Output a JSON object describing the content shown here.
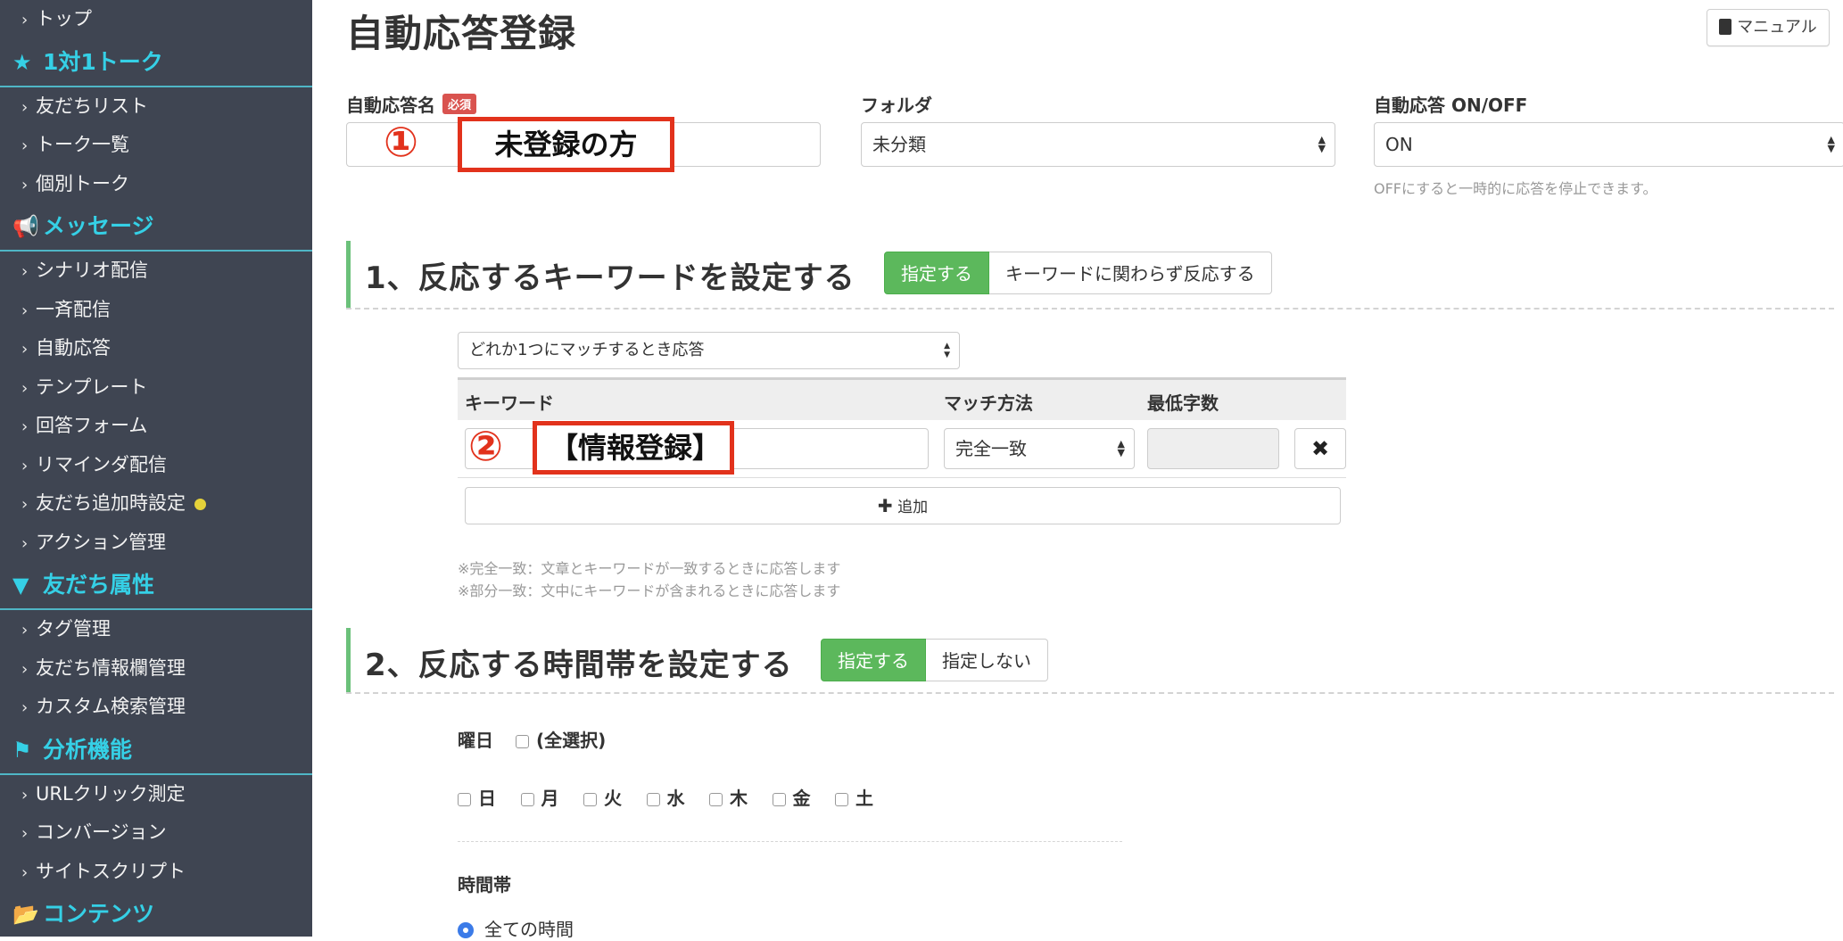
{
  "sidebar": {
    "items": [
      {
        "kind": "item",
        "label": "トップ"
      },
      {
        "kind": "section",
        "label": "1対1トーク",
        "icon": "star-icon",
        "glyph": "★"
      },
      {
        "kind": "item",
        "label": "友だちリスト"
      },
      {
        "kind": "item",
        "label": "トーク一覧"
      },
      {
        "kind": "item",
        "label": "個別トーク"
      },
      {
        "kind": "section",
        "label": "メッセージ",
        "icon": "megaphone-icon",
        "glyph": "📢"
      },
      {
        "kind": "item",
        "label": "シナリオ配信"
      },
      {
        "kind": "item",
        "label": "一斉配信"
      },
      {
        "kind": "item",
        "label": "自動応答"
      },
      {
        "kind": "item",
        "label": "テンプレート"
      },
      {
        "kind": "item",
        "label": "回答フォーム"
      },
      {
        "kind": "item",
        "label": "リマインダ配信"
      },
      {
        "kind": "item",
        "label": "友だち追加時設定",
        "dot": true
      },
      {
        "kind": "item",
        "label": "アクション管理"
      },
      {
        "kind": "section",
        "label": "友だち属性",
        "icon": "filter-icon",
        "glyph": "▼"
      },
      {
        "kind": "item",
        "label": "タグ管理"
      },
      {
        "kind": "item",
        "label": "友だち情報欄管理"
      },
      {
        "kind": "item",
        "label": "カスタム検索管理"
      },
      {
        "kind": "section",
        "label": "分析機能",
        "icon": "flag-icon",
        "glyph": "⚑"
      },
      {
        "kind": "item",
        "label": "URLクリック測定"
      },
      {
        "kind": "item",
        "label": "コンバージョン"
      },
      {
        "kind": "item",
        "label": "サイトスクリプト"
      },
      {
        "kind": "section",
        "label": "コンテンツ",
        "icon": "folder-open-icon",
        "glyph": "📂"
      }
    ]
  },
  "header": {
    "title": "自動応答登録",
    "manual_label": "マニュアル"
  },
  "form": {
    "name_label": "自動応答名",
    "required_badge": "必須",
    "name_value": "未登録の方",
    "name_marker": "①",
    "folder_label": "フォルダ",
    "folder_value": "未分類",
    "onoff_label": "自動応答 ON/OFF",
    "onoff_value": "ON",
    "onoff_help": "OFFにすると一時的に応答を停止できます。"
  },
  "section1": {
    "title": "1、反応するキーワードを設定する",
    "toggle_on": "指定する",
    "toggle_off": "キーワードに関わらず反応する",
    "match_mode": "どれか1つにマッチするとき応答",
    "columns": {
      "keyword": "キーワード",
      "match": "マッチ方法",
      "min_chars": "最低字数"
    },
    "row": {
      "keyword": "【情報登録】",
      "marker": "②",
      "match": "完全一致",
      "min_chars": ""
    },
    "delete_glyph": "✖",
    "add_label": "追加",
    "notes": [
      "※完全一致：文章とキーワードが一致するときに応答します",
      "※部分一致：文中にキーワードが含まれるときに応答します"
    ]
  },
  "section2": {
    "title": "2、反応する時間帯を設定する",
    "toggle_on": "指定する",
    "toggle_off": "指定しない",
    "weekday_label": "曜日",
    "select_all": "(全選択)",
    "days": [
      "日",
      "月",
      "火",
      "水",
      "木",
      "金",
      "土"
    ],
    "time_label": "時間帯",
    "time_option": "全ての時間"
  },
  "colors": {
    "sidebar_bg": "#3f4552",
    "accent_cyan": "#35d0e6",
    "green": "#5cb85c",
    "annotation_red": "#e2321c"
  }
}
